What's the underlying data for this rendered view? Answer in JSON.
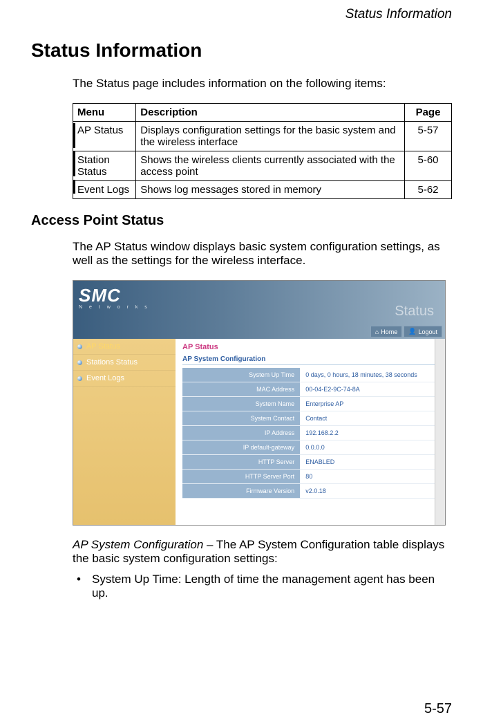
{
  "running_header": "Status Information",
  "heading": "Status Information",
  "intro": "The Status page includes information on the following items:",
  "table": {
    "headers": {
      "menu": "Menu",
      "description": "Description",
      "page": "Page"
    },
    "rows": [
      {
        "menu": "AP Status",
        "desc": "Displays configuration settings for the basic system and the wireless interface",
        "page": "5-57"
      },
      {
        "menu": "Station Status",
        "desc": "Shows the wireless clients currently associated with the access point",
        "page": "5-60"
      },
      {
        "menu": "Event Logs",
        "desc": "Shows log messages stored in memory",
        "page": "5-62"
      }
    ]
  },
  "subheading": "Access Point Status",
  "sub_intro": "The AP Status window displays basic system configuration settings, as well as the settings for the wireless interface.",
  "caption_term": "AP System Configuration",
  "caption_rest": " – The AP System Configuration table displays the basic system configuration settings:",
  "bullet1": "System Up Time: Length of time the management agent has been up.",
  "page_number": "5-57",
  "ui": {
    "logo": "SMC",
    "sublogo": "N e t w o r k s",
    "banner_word": "Status",
    "home_label": "Home",
    "logout_label": "Logout",
    "side": {
      "item1": "AP Status",
      "item2": "Stations Status",
      "item3": "Event Logs"
    },
    "main_title_prefix": "AP ",
    "main_title_word": "Status",
    "section_title": "AP System Configuration",
    "cfg": [
      {
        "label": "System Up Time",
        "value": "0 days, 0 hours, 18 minutes, 38 seconds"
      },
      {
        "label": "MAC Address",
        "value": "00-04-E2-9C-74-8A"
      },
      {
        "label": "System Name",
        "value": "Enterprise AP"
      },
      {
        "label": "System Contact",
        "value": "Contact"
      },
      {
        "label": "IP Address",
        "value": "192.168.2.2"
      },
      {
        "label": "IP default-gateway",
        "value": "0.0.0.0"
      },
      {
        "label": "HTTP Server",
        "value": "ENABLED"
      },
      {
        "label": "HTTP Server Port",
        "value": "80"
      },
      {
        "label": "Firmware Version",
        "value": "v2.0.18"
      }
    ]
  }
}
